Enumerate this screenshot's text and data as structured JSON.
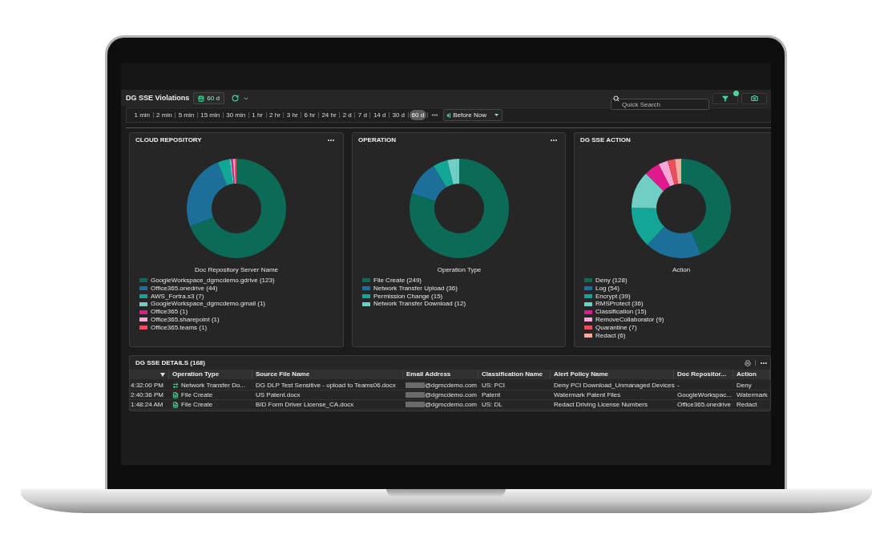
{
  "header": {
    "title": "DG SSE Violations",
    "range_button": "60 d",
    "search": {
      "placeholder": "Quick Search"
    },
    "filter_active": true
  },
  "time_ranges": [
    {
      "label": "1 min",
      "selected": false
    },
    {
      "label": "2 min",
      "selected": false
    },
    {
      "label": "5 min",
      "selected": false
    },
    {
      "label": "15 min",
      "selected": false
    },
    {
      "label": "30 min",
      "selected": false
    },
    {
      "label": "1 hr",
      "selected": false
    },
    {
      "label": "2 hr",
      "selected": false
    },
    {
      "label": "3 hr",
      "selected": false
    },
    {
      "label": "6 hr",
      "selected": false
    },
    {
      "label": "24 hr",
      "selected": false
    },
    {
      "label": "2 d",
      "selected": false
    },
    {
      "label": "7 d",
      "selected": false
    },
    {
      "label": "14 d",
      "selected": false
    },
    {
      "label": "30 d",
      "selected": false
    },
    {
      "label": "60 d",
      "selected": true
    }
  ],
  "anchor_select": {
    "value": "Before Now"
  },
  "panels": [
    {
      "title": "CLOUD REPOSITORY",
      "cut_off": false,
      "chart_data": {
        "type": "donut",
        "xlabel": "Doc Repository Server Name",
        "categories": [
          "GoogleWorkspace_dgmcdemo.gdrive (123)",
          "Office365.onedrive (44)",
          "AWS_Fortra.s3 (7)",
          "GoogleWorkspace_dgmcdemo.gmail (1)",
          "Office365 (1)",
          "Office365.sharepoint (1)",
          "Office365.teams (1)"
        ],
        "values": [
          123,
          44,
          7,
          1,
          1,
          1,
          1
        ],
        "colors": [
          "#0b6b57",
          "#1b6f98",
          "#13a596",
          "#6fcfc4",
          "#e0198c",
          "#f5a8d6",
          "#e9505c"
        ]
      }
    },
    {
      "title": "OPERATION",
      "cut_off": false,
      "chart_data": {
        "type": "donut",
        "xlabel": "Operation Type",
        "categories": [
          "File Create (249)",
          "Network Transfer Upload (36)",
          "Permission Change (15)",
          "Network Transfer Download (12)"
        ],
        "values": [
          249,
          36,
          15,
          12
        ],
        "colors": [
          "#0b6b57",
          "#1b6f98",
          "#13a596",
          "#6fcfc4"
        ]
      }
    },
    {
      "title": "DG SSE ACTION",
      "cut_off": true,
      "chart_data": {
        "type": "donut",
        "xlabel": "Action",
        "categories": [
          "Deny (128)",
          "Log (54)",
          "Encrypt (39)",
          "RMSProtect (36)",
          "Classification (15)",
          "RemoveCollaborator (9)",
          "Quarantine (7)",
          "Redact (6)"
        ],
        "values": [
          128,
          54,
          39,
          36,
          15,
          9,
          7,
          6
        ],
        "colors": [
          "#0b6b57",
          "#1b6f98",
          "#13a596",
          "#6fcfc4",
          "#e0198c",
          "#f5a8d6",
          "#e9505c",
          "#f7a8a0"
        ]
      }
    }
  ],
  "details": {
    "title": "DG SSE DETAILS (168)",
    "columns": [
      {
        "kind": "time",
        "sorted_descending": true
      },
      {
        "kind": "text",
        "label": "Operation Type"
      },
      {
        "kind": "text",
        "label": "Source File Name"
      },
      {
        "kind": "text",
        "label": "Email Address"
      },
      {
        "kind": "text",
        "label": "Classification Name"
      },
      {
        "kind": "text",
        "label": "Alert Policy Name"
      },
      {
        "kind": "text",
        "label": "Doc Repositor..."
      },
      {
        "kind": "text",
        "label": "Action"
      }
    ],
    "rows": [
      {
        "time": "4:32:00 PM",
        "operation": {
          "kind": "transfer",
          "label": "Network Transfer Do..."
        },
        "source_file": "DG DLP Test Sensitive - upload to Teams06.docx",
        "email": {
          "redacted": true,
          "text": "@dgmcdemo.com"
        },
        "classification": "US: PCI",
        "alert_policy": "Deny PCI Download_Unmanaged Devices",
        "doc_repository": "-",
        "action": "Deny"
      },
      {
        "time": "2:40:36 PM",
        "operation": {
          "kind": "file",
          "label": "File Create"
        },
        "source_file": "US Patent.docx",
        "email": {
          "redacted": true,
          "text": "@dgmcdemo.com"
        },
        "classification": "Patent",
        "alert_policy": "Watermark Patent Files",
        "doc_repository": "GoogleWorkspac...",
        "action": "Watermark"
      },
      {
        "time": "1:48:24 AM",
        "operation": {
          "kind": "file",
          "label": "File Create"
        },
        "source_file": "BID Form Driver License_CA.docx",
        "email": {
          "redacted": true,
          "text": "@dgmcdemo.com"
        },
        "classification": "US: DL",
        "alert_policy": "Redact Driving License Numbers",
        "doc_repository": "Office365.onedrive",
        "action": "Redact"
      }
    ]
  }
}
